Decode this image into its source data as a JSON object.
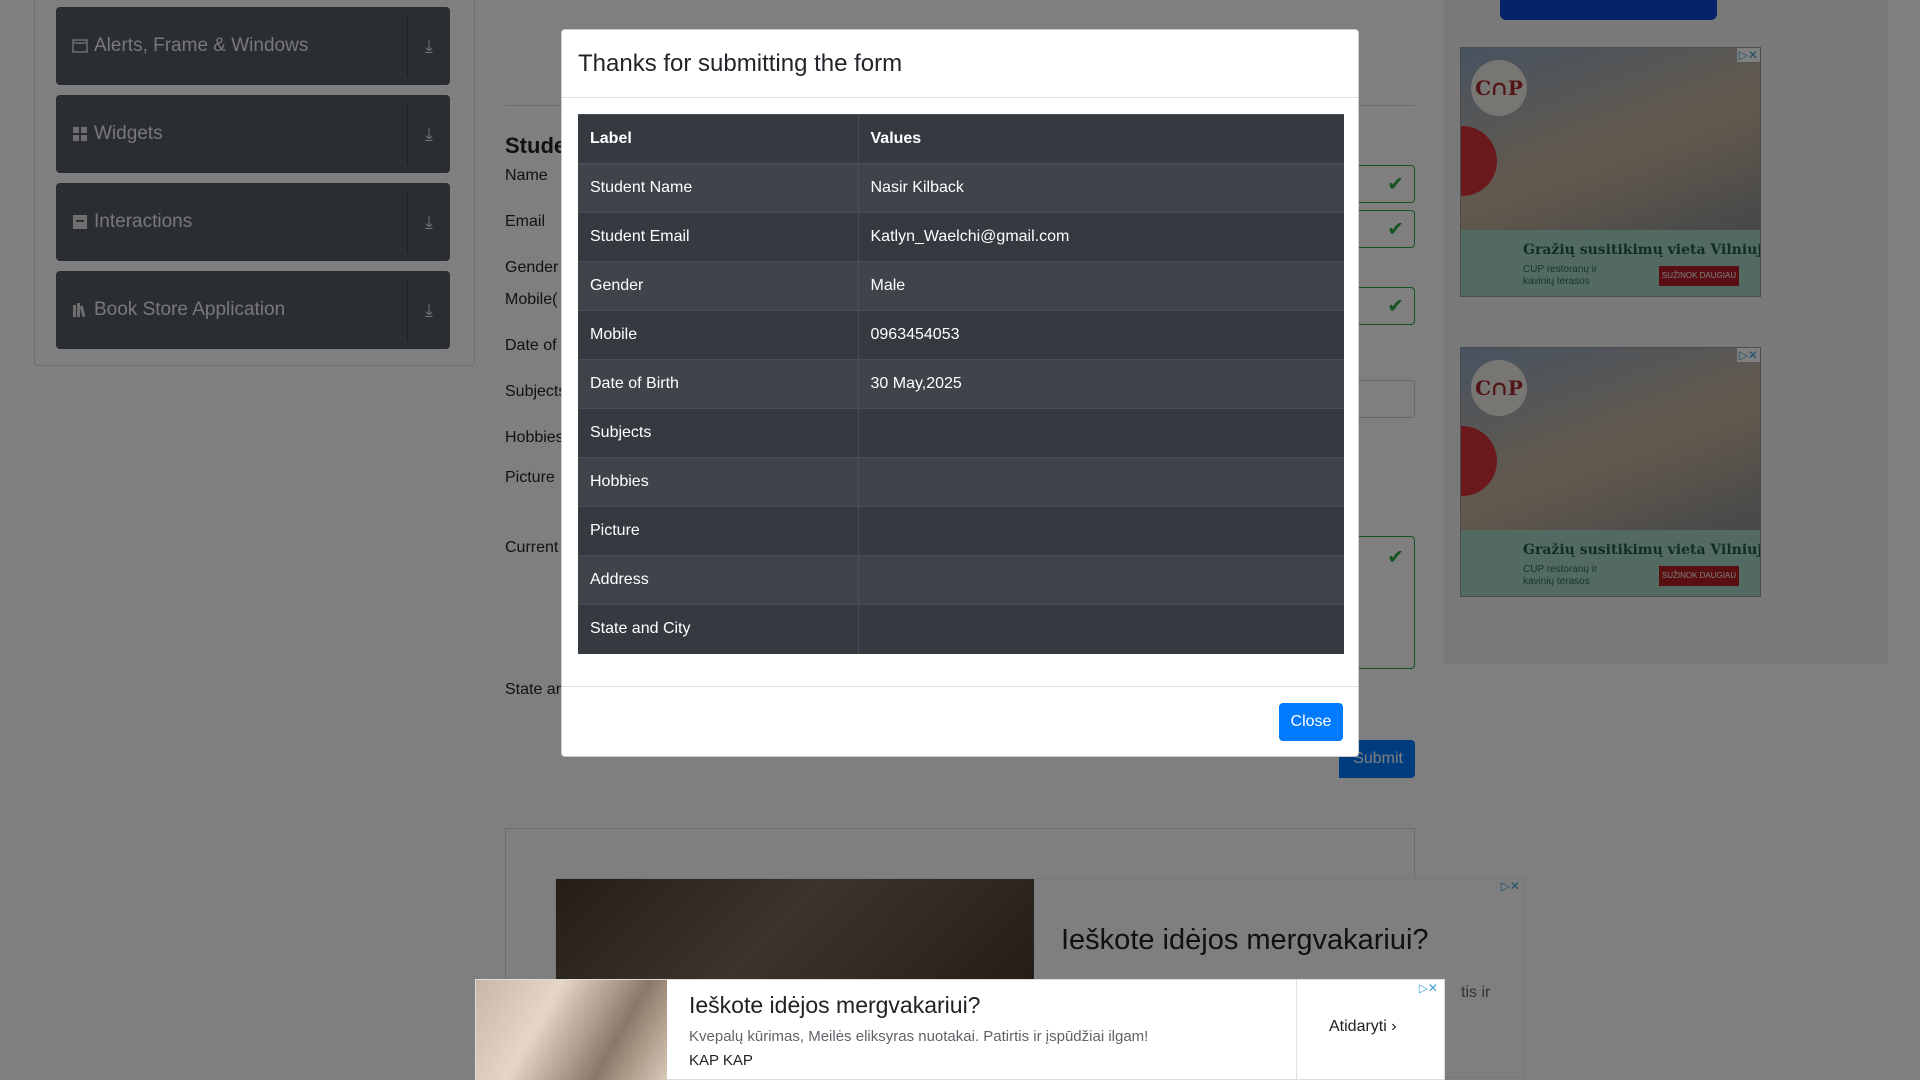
{
  "sidebar": {
    "groups": [
      {
        "label": "Alerts, Frame & Windows",
        "icon": "window-icon"
      },
      {
        "label": "Widgets",
        "icon": "widgets-grid-icon"
      },
      {
        "label": "Interactions",
        "icon": "interactions-icon"
      },
      {
        "label": "Book Store Application",
        "icon": "books-icon"
      }
    ]
  },
  "form": {
    "heading": "Studen",
    "labels": [
      "Name",
      "Email",
      "Gender",
      "Mobile(",
      "Date of",
      "Subjects",
      "Hobbies",
      "Picture",
      "Current",
      "State an"
    ],
    "submit_label": "Submit"
  },
  "ads": {
    "side_logo": "C∩P",
    "side_title": "Gražių susitikimų vieta Vilniuje",
    "side_sub": "CUP restoranų ir kavinių terasos",
    "side_button": "SUŽINOK DAUGIAU",
    "big_headline": "Ieškote idėjos mergvakariui?",
    "big_sub": "tis ir",
    "sticky_headline": "Ieškote idėjos mergvakariui?",
    "sticky_desc": "Kvepalų kūrimas, Meilės eliksyras nuotakai. Patirtis ir įspūdžiai ilgam!",
    "sticky_brand": "KAP KAP",
    "sticky_cta": "Atidaryti"
  },
  "modal": {
    "title": "Thanks for submitting the form",
    "table": {
      "headers": [
        "Label",
        "Values"
      ],
      "rows": [
        {
          "label": "Student Name",
          "value": "Nasir Kilback"
        },
        {
          "label": "Student Email",
          "value": "Katlyn_Waelchi@gmail.com"
        },
        {
          "label": "Gender",
          "value": "Male"
        },
        {
          "label": "Mobile",
          "value": "0963454053"
        },
        {
          "label": "Date of Birth",
          "value": "30 May,2025"
        },
        {
          "label": "Subjects",
          "value": ""
        },
        {
          "label": "Hobbies",
          "value": ""
        },
        {
          "label": "Picture",
          "value": ""
        },
        {
          "label": "Address",
          "value": ""
        },
        {
          "label": "State and City",
          "value": ""
        }
      ]
    },
    "close_label": "Close"
  },
  "colors": {
    "primary": "#007bff",
    "valid": "#28a745",
    "table_dark": "#343a40",
    "sidebar_group": "#545a62"
  }
}
